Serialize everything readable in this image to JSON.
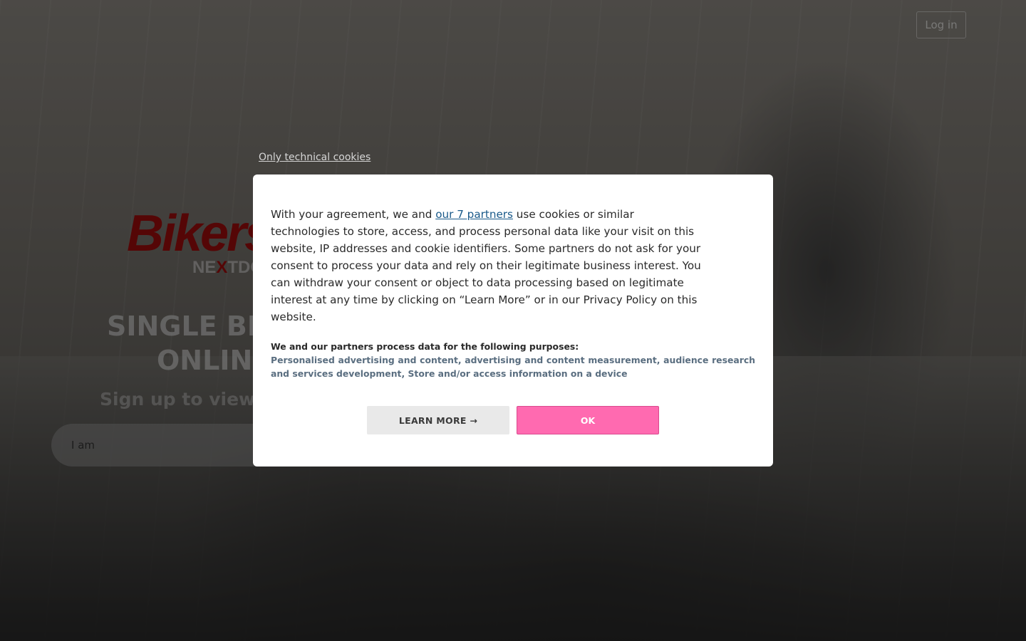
{
  "header": {
    "login_label": "Log in"
  },
  "brand": {
    "logo_main": "Bikers",
    "logo_sub_prefix": "NE",
    "logo_sub_x": "X",
    "logo_sub_suffix": "TDO",
    "accent_color": "#9b0c0c"
  },
  "hero": {
    "title_line1": "SINGLE BIK",
    "title_line2": "ONLIN",
    "subtitle": "Sign up to view p",
    "gender_select_value": "I am"
  },
  "cookie_banner": {
    "technical_link": "Only technical cookies",
    "intro_before_link": "With your agreement, we and ",
    "partners_link": "our 7 partners",
    "intro_after_link": " use cookies or similar technologies to store, access, and process personal data like your visit on this website, IP addresses and cookie identifiers. Some partners do not ask for your consent to process your data and rely on their legitimate business interest. You can withdraw your consent or object to data processing based on legitimate interest at any time by clicking on “Learn More” or in our Privacy Policy on this website.",
    "purposes_heading": "We and our partners process data for the following purposes:",
    "purposes_list": "Personalised advertising and content, advertising and content measurement, audience research and services development, Store and/or access information on a device",
    "learn_more_label": "LEARN MORE →",
    "ok_label": "OK",
    "ok_color": "#ff6ab0"
  }
}
